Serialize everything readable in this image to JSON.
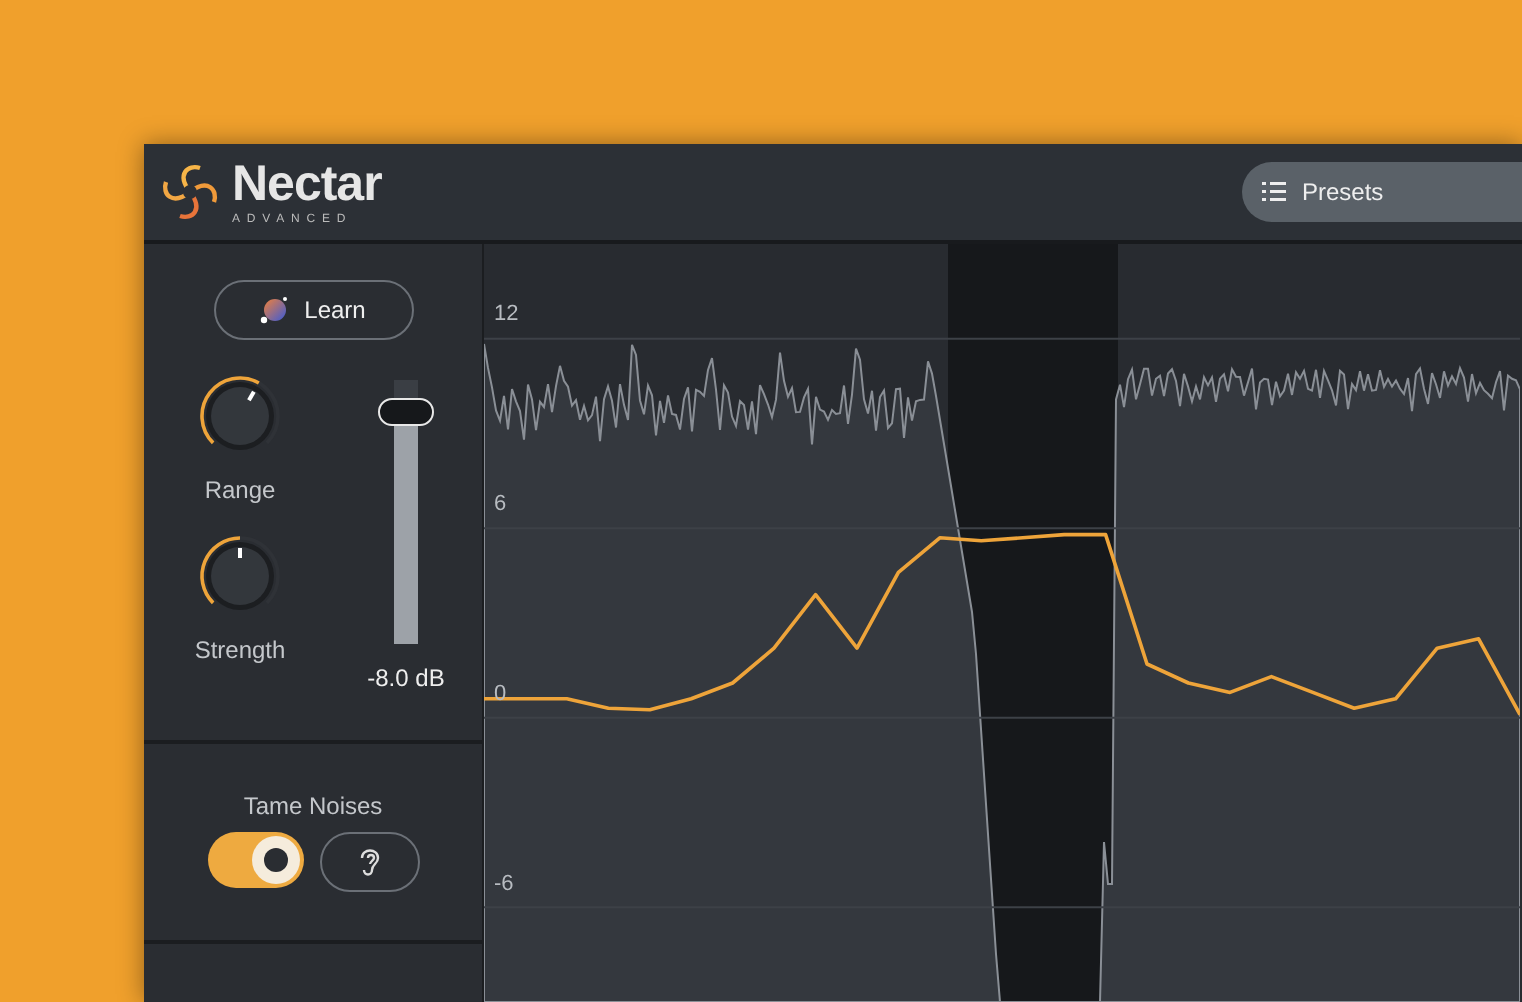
{
  "app": {
    "name": "Nectar",
    "edition": "ADVANCED"
  },
  "presets": {
    "label": "Presets"
  },
  "learn_button": {
    "label": "Learn"
  },
  "knobs": [
    {
      "label": "Range",
      "level": 0.61
    },
    {
      "label": "Strength",
      "level": 0.5
    }
  ],
  "fader": {
    "level": 0.88,
    "reading": "-8.0 dB"
  },
  "tame_noises": {
    "label": "Tame Noises",
    "on": true
  },
  "graph": {
    "chart_data": {
      "type": "line",
      "yticks": [
        12,
        6,
        0,
        -6
      ],
      "ylim": [
        -9,
        15
      ],
      "grid": true,
      "series": [
        {
          "color": "#eea43a",
          "values": [
            0.6,
            0.6,
            0.6,
            0.3,
            0.25,
            0.6,
            1.1,
            2.2,
            3.9,
            2.2,
            4.6,
            5.7,
            5.6,
            5.7,
            5.8,
            5.8,
            1.7,
            1.1,
            0.8,
            1.3,
            0.8,
            0.3,
            0.6,
            2.2,
            2.5,
            0.1
          ]
        }
      ]
    }
  }
}
